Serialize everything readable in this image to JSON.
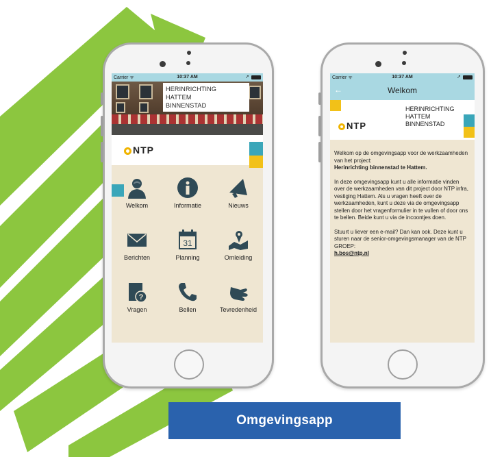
{
  "brand": {
    "green": "#8cc63f",
    "teal": "#3aa6b9",
    "yellow": "#f2c118",
    "banner_blue": "#2a62ad",
    "nav_blue": "#a9d8e2"
  },
  "statusbar": {
    "carrier": "Carrier ᯤ",
    "time": "10:37 AM"
  },
  "home_screen": {
    "title_lines": [
      "HERINRICHTING",
      "HATTEM",
      "BINNENSTAD"
    ],
    "logo_text": "NTP",
    "tiles": [
      {
        "label": "Welkom",
        "icon": "person-icon"
      },
      {
        "label": "Informatie",
        "icon": "info-icon"
      },
      {
        "label": "Nieuws",
        "icon": "megaphone-icon"
      },
      {
        "label": "Berichten",
        "icon": "envelope-icon"
      },
      {
        "label": "Planning",
        "icon": "calendar-icon",
        "calendar_day": "31"
      },
      {
        "label": "Omleiding",
        "icon": "map-pin-icon"
      },
      {
        "label": "Vragen",
        "icon": "question-icon"
      },
      {
        "label": "Bellen",
        "icon": "phone-icon"
      },
      {
        "label": "Tevredenheid",
        "icon": "hand-icon"
      }
    ]
  },
  "welcome_screen": {
    "nav_title": "Welkom",
    "back_icon": "back-arrow-icon",
    "title_lines": [
      "HERINRICHTING",
      "HATTEM",
      "BINNENSTAD"
    ],
    "logo_text": "NTP",
    "para1_lead": "Welkom op de omgevingsapp voor de werkzaamheden van het project:",
    "para1_bold": "Herinrichting binnenstad te Hattem.",
    "para2": "In deze omgevingsapp kunt u alle informatie vinden over de werkzaamheden van dit project door NTP infra, vestiging Hattem. Als u vragen heeft over de werkzaamheden, kunt u deze via de omgevingsapp stellen door het vragenformulier in te vullen of door ons te bellen. Beide kunt u via de incoontjes doen.",
    "para3": "Stuurt u liever een e-mail? Dan kan ook. Deze kunt u sturen naar de senior-omgevingsmanager van de NTP GROEP:",
    "email": "h.bos@ntp.nl"
  },
  "banner": {
    "label": "Omgevingsapp"
  }
}
